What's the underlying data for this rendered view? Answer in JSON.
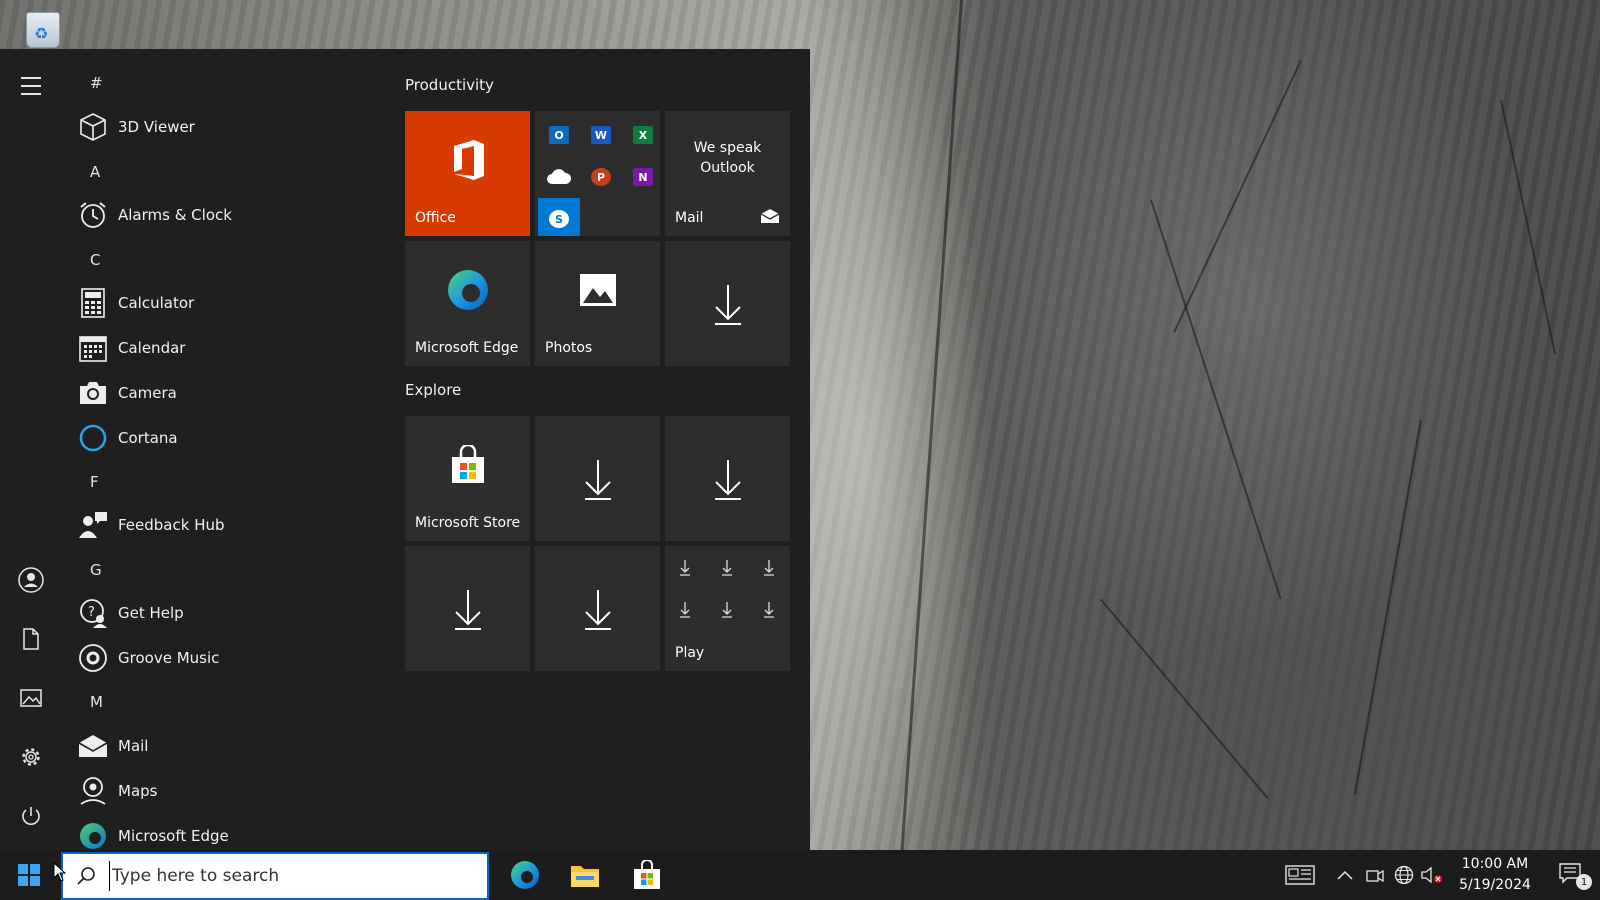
{
  "start_menu": {
    "app_list": [
      {
        "type": "letter",
        "text": "#"
      },
      {
        "type": "app",
        "label": "3D Viewer",
        "icon": "cube-icon"
      },
      {
        "type": "letter",
        "text": "A"
      },
      {
        "type": "app",
        "label": "Alarms & Clock",
        "icon": "alarm-clock-icon"
      },
      {
        "type": "letter",
        "text": "C"
      },
      {
        "type": "app",
        "label": "Calculator",
        "icon": "calculator-icon"
      },
      {
        "type": "app",
        "label": "Calendar",
        "icon": "calendar-icon"
      },
      {
        "type": "app",
        "label": "Camera",
        "icon": "camera-icon"
      },
      {
        "type": "app",
        "label": "Cortana",
        "icon": "cortana-icon"
      },
      {
        "type": "letter",
        "text": "F"
      },
      {
        "type": "app",
        "label": "Feedback Hub",
        "icon": "feedback-hub-icon"
      },
      {
        "type": "letter",
        "text": "G"
      },
      {
        "type": "app",
        "label": "Get Help",
        "icon": "get-help-icon"
      },
      {
        "type": "app",
        "label": "Groove Music",
        "icon": "groove-music-icon"
      },
      {
        "type": "letter",
        "text": "M"
      },
      {
        "type": "app",
        "label": "Mail",
        "icon": "mail-icon"
      },
      {
        "type": "app",
        "label": "Maps",
        "icon": "maps-icon"
      },
      {
        "type": "app",
        "label": "Microsoft Edge",
        "icon": "edge-icon"
      }
    ],
    "groups": {
      "productivity": "Productivity",
      "explore": "Explore"
    },
    "tiles": {
      "office": "Office",
      "mail_tile_text": "We speak Outlook",
      "mail": "Mail",
      "edge": "Microsoft Edge",
      "photos": "Photos",
      "store": "Microsoft Store",
      "play": "Play"
    },
    "office_apps": [
      "O",
      "W",
      "X",
      "cloud",
      "P",
      "N",
      "S"
    ]
  },
  "taskbar": {
    "search_placeholder": "Type here to search",
    "clock_time": "10:00 AM",
    "clock_date": "5/19/2024",
    "notification_count": "1"
  },
  "colors": {
    "office_tile": "#d83b01",
    "accent": "#0a64c8",
    "start_bg": "#1f1f1f",
    "tile_bg": "#2d2d2d"
  }
}
